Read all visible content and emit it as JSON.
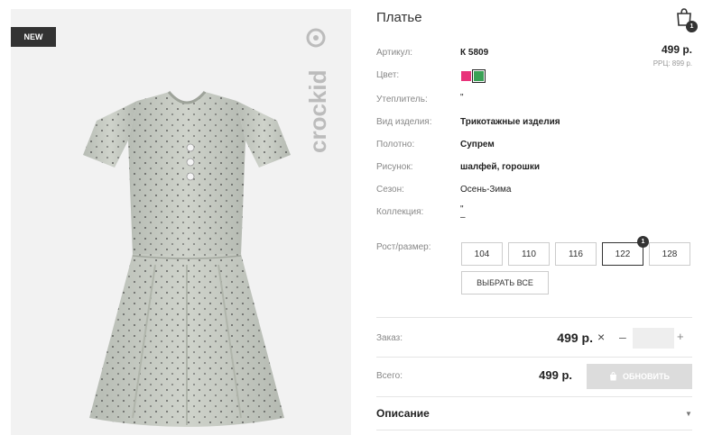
{
  "image_panel": {
    "badge": "NEW",
    "brand_logo": "crockid"
  },
  "product": {
    "title": "Платье",
    "price": "499 р.",
    "rrp": "РРЦ: 899 р."
  },
  "header": {
    "cart_icon": "shopping-bag-icon",
    "cart_count": "1"
  },
  "attributes": {
    "article_label": "Артикул:",
    "article_value": "К 5809",
    "color_label": "Цвет:",
    "insulation_label": "Утеплитель:",
    "insulation_value": "\"",
    "type_label": "Вид изделия:",
    "type_value": "Трикотажные изделия",
    "fabric_label": "Полотно:",
    "fabric_value": "Супрем",
    "pattern_label": "Рисунок:",
    "pattern_value": "шалфей, горошки",
    "season_label": "Сезон:",
    "season_value": "Осень-Зима",
    "collection_label": "Коллекция:",
    "collection_value": "\"",
    "collection_value_2": "–"
  },
  "colors": [
    {
      "name": "pink",
      "hex": "#e8337a"
    },
    {
      "name": "green",
      "hex": "#3aa155",
      "selected": true
    }
  ],
  "sizes": {
    "label": "Рост/размер:",
    "options": [
      "104",
      "110",
      "116",
      "122",
      "128"
    ],
    "selected": "122",
    "selected_badge": "1",
    "select_all": "ВЫБРАТЬ ВСЕ"
  },
  "order": {
    "label": "Заказ:",
    "price": "499 р.",
    "remove_icon": "×",
    "minus": "–",
    "plus": "+",
    "quantity": ""
  },
  "total": {
    "label": "Всего:",
    "price": "499 р.",
    "update_button": "ОБНОВИТЬ"
  },
  "description": {
    "label": "Описание",
    "arrow": "▼"
  }
}
